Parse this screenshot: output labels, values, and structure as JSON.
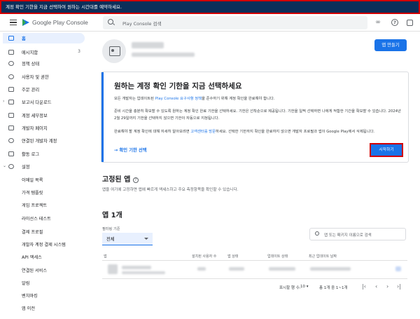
{
  "banner": {
    "text": "계정 확인 기한을 지금 선택하여 원하는 시간대를 예약하세요."
  },
  "topbar": {
    "brand": "Google Play Console",
    "search_placeholder": "Play Console 검색"
  },
  "sidebar": {
    "items": [
      {
        "label": "홈",
        "icon": "home-icon"
      },
      {
        "label": "메시지함",
        "icon": "inbox-icon",
        "count": "3"
      },
      {
        "label": "정책 상태",
        "icon": "shield-icon"
      },
      {
        "label": "사용자 및 권한",
        "icon": "people-icon"
      },
      {
        "label": "주문 관리",
        "icon": "card-icon"
      },
      {
        "label": "보고서 다운로드",
        "icon": "download-icon"
      },
      {
        "label": "계정 세부정보",
        "icon": "account-details-icon"
      },
      {
        "label": "개발자 페이지",
        "icon": "developer-page-icon"
      },
      {
        "label": "연결된 개발자 계정",
        "icon": "linked-accounts-icon"
      },
      {
        "label": "활동 로그",
        "icon": "log-icon"
      },
      {
        "label": "설정",
        "icon": "gear-icon"
      }
    ],
    "settings_sub": [
      "이메일 목록",
      "가격 템플릿",
      "게임 프로젝트",
      "라이선스 테스트",
      "결제 프로필",
      "개발자 계정 결제 시스템",
      "API 액세스",
      "연결된 서비스",
      "알림",
      "벤치마킹",
      "앱 이전"
    ]
  },
  "main": {
    "create_app": "앱 만들기",
    "card": {
      "title": "원하는 계정 확인 기한을 지금 선택하세요",
      "p1_a": "모든 개발자는 업데이트된 ",
      "p1_link": "Play Console 요구사항 정책",
      "p1_b": "을 준수하기 위해 계정 확인을 완료해야 합니다.",
      "p2": "준비 시간을 충분히 확보할 수 있도록 원하는 계정 확인 완료 기한을 선택하세요. 기한은 선착순으로 제공됩니다. 기한을 일찍 선택하면 나에게 적합한 기간을 확보할 수 있습니다. 2024년 2월 29일까지 기한을 선택하지 않으면 기한이 자동으로 지정됩니다.",
      "p3_a": "완료해야 할 계정 확인에 대해 자세히 알아보려면 ",
      "p3_link": "고객센터를 방문",
      "p3_b": "하세요. 선택한 기한까지 확인을 완료하지 않으면 개발자 프로필과 앱이 Google Play에서 삭제됩니다.",
      "action": "확인 기한 선택",
      "start": "시작하기"
    },
    "pinned": {
      "title": "고정된 앱",
      "desc": "앱을 여기에 고정하면 앱에 빠르게 액세스하고 주요 측정항목을 확인할 수 있습니다."
    },
    "apps": {
      "title": "앱 1개",
      "filter_label": "필터링 기준",
      "filter_value": "전체",
      "search_placeholder": "앱 또는 패키지 이름으로 검색",
      "columns": [
        "앱",
        "설치된 사용자 수",
        "앱 상태",
        "업데이트 상태",
        "최근 업데이트 날짜"
      ],
      "rows_per_page_label": "표시할 행 수:",
      "rows_per_page": "10",
      "range": "총 1개 중 1~1개"
    }
  }
}
